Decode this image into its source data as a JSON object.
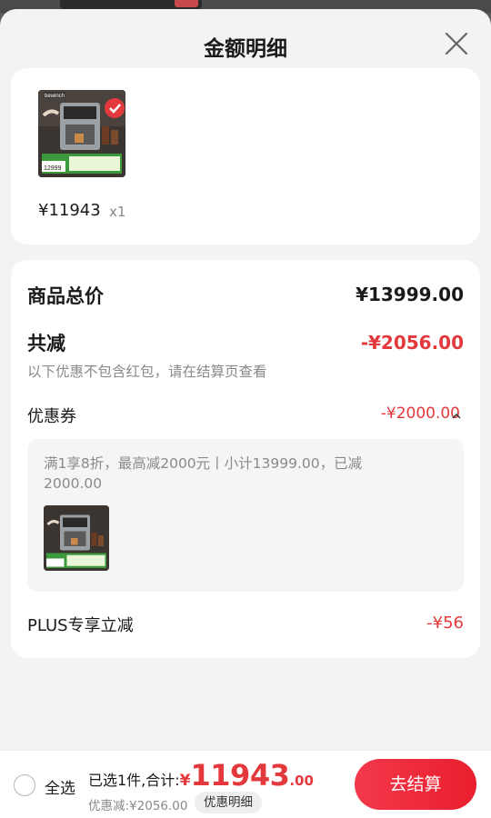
{
  "sheet": {
    "title": "金额明细"
  },
  "product": {
    "brand_mark": "bewinch",
    "price": "¥11943",
    "qty": "x1",
    "thumb_promo": "政府补贴享8折 全国可使用",
    "thumb_price": "12999"
  },
  "detail": {
    "total_label": "商品总价",
    "total_value": "¥13999.00",
    "reduce_label": "共减",
    "reduce_value": "-¥2056.00",
    "reduce_note": "以下优惠不包含红包，请在结算页查看",
    "coupon_label": "优惠券",
    "coupon_value": "-¥2000.00",
    "coupon_desc": "满1享8折，最高减2000元丨小计13999.00，已减2000.00",
    "plus_label": "PLUS专享立减",
    "plus_value": "-¥56"
  },
  "bottom": {
    "select_all": "全选",
    "summary_prefix": "已选1件,合计:",
    "yen": "¥",
    "total_int": "11943",
    "total_dec": ".00",
    "discount": "优惠减:¥2056.00",
    "detail_chip": "优惠明细",
    "checkout": "去结算"
  },
  "colors": {
    "accent": "#e4393c",
    "checkout_bg": "#ec2534"
  }
}
